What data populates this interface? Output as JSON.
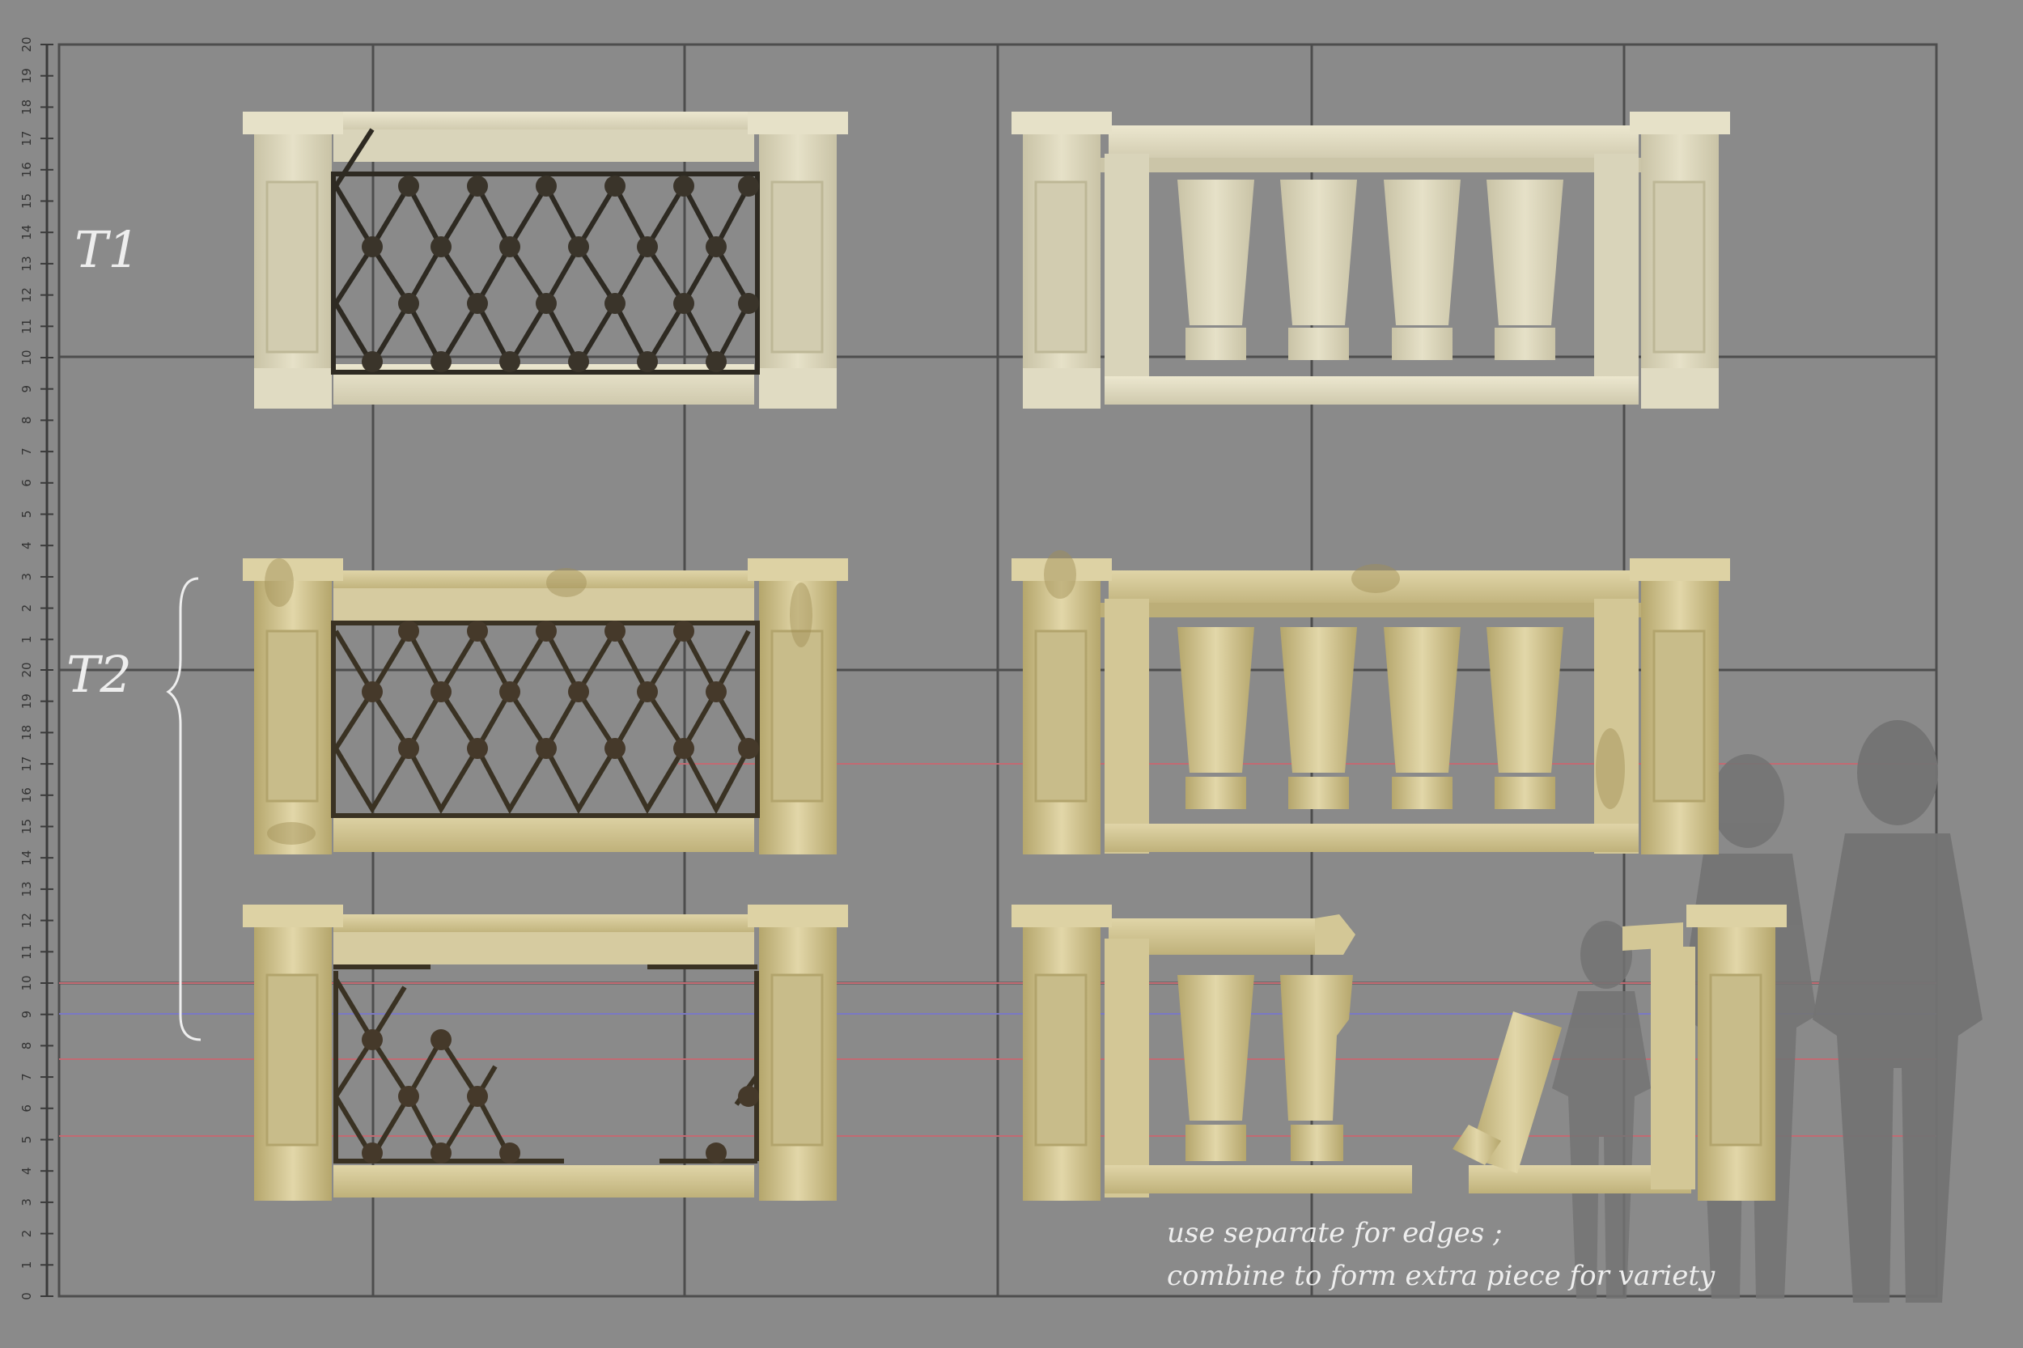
{
  "rows": {
    "t1": {
      "label": "T1"
    },
    "t2": {
      "label": "T2"
    }
  },
  "ruler": {
    "upper_ticks": [
      "20",
      "19",
      "18",
      "17",
      "16",
      "15",
      "14",
      "13",
      "12",
      "11",
      "10",
      "9",
      "8",
      "7",
      "6",
      "5",
      "4",
      "3",
      "2",
      "1"
    ],
    "lower_ticks": [
      "20",
      "19",
      "18",
      "17",
      "16",
      "15",
      "14",
      "13",
      "12",
      "11",
      "10",
      "9",
      "8",
      "7",
      "6",
      "5",
      "4",
      "3",
      "2",
      "1",
      "0"
    ]
  },
  "notes": {
    "line1": "use separate for edges ;",
    "line2": "combine to form extra piece for variety"
  },
  "colors": {
    "background": "#8a8a8a",
    "grid": "#4a4a4a",
    "stone_clean": "#ddd8bf",
    "stone_dirty": "#c9bd8c",
    "iron": "#2e2a22",
    "guide_red": "#c26a72",
    "guide_blue": "#7a78c4",
    "silhouette": "#737373"
  }
}
